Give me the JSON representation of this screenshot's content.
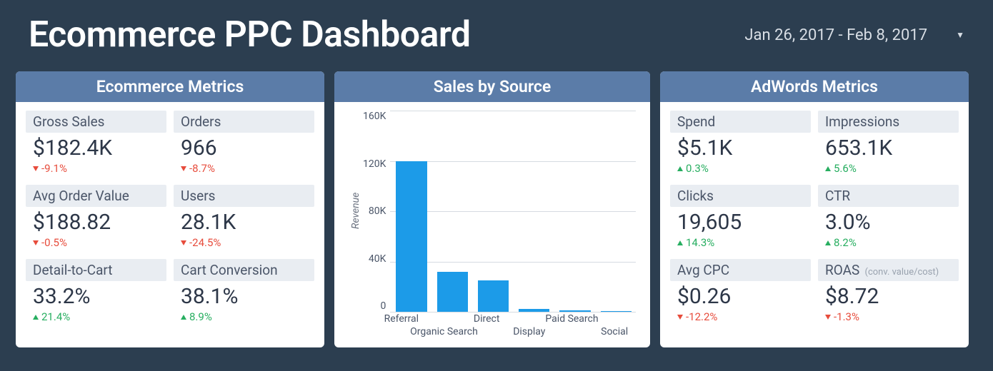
{
  "header": {
    "title": "Ecommerce PPC Dashboard",
    "date_range": "Jan 26, 2017 - Feb 8, 2017"
  },
  "panels": {
    "ecommerce": {
      "title": "Ecommerce Metrics",
      "metrics": [
        {
          "label": "Gross Sales",
          "value": "$182.4K",
          "delta": "-9.1%",
          "dir": "down"
        },
        {
          "label": "Orders",
          "value": "966",
          "delta": "-8.7%",
          "dir": "down"
        },
        {
          "label": "Avg Order Value",
          "value": "$188.82",
          "delta": "-0.5%",
          "dir": "down"
        },
        {
          "label": "Users",
          "value": "28.1K",
          "delta": "-24.5%",
          "dir": "down"
        },
        {
          "label": "Detail-to-Cart",
          "value": "33.2%",
          "delta": "21.4%",
          "dir": "up"
        },
        {
          "label": "Cart Conversion",
          "value": "38.1%",
          "delta": "8.9%",
          "dir": "up"
        }
      ]
    },
    "sales": {
      "title": "Sales by Source"
    },
    "adwords": {
      "title": "AdWords Metrics",
      "metrics": [
        {
          "label": "Spend",
          "value": "$5.1K",
          "delta": "0.3%",
          "dir": "up"
        },
        {
          "label": "Impressions",
          "value": "653.1K",
          "delta": "5.6%",
          "dir": "up"
        },
        {
          "label": "Clicks",
          "value": "19,605",
          "delta": "14.3%",
          "dir": "up"
        },
        {
          "label": "CTR",
          "value": "3.0%",
          "delta": "8.2%",
          "dir": "up"
        },
        {
          "label": "Avg CPC",
          "value": "$0.26",
          "delta": "-12.2%",
          "dir": "down"
        },
        {
          "label": "ROAS",
          "sublabel": "(conv. value/cost)",
          "value": "$8.72",
          "delta": "-1.3%",
          "dir": "down"
        }
      ]
    }
  },
  "chart_data": {
    "type": "bar",
    "title": "Sales by Source",
    "ylabel": "Revenue",
    "xlabel": "",
    "ylim": [
      0,
      160000
    ],
    "yticks": [
      "160K",
      "120K",
      "80K",
      "40K",
      "0"
    ],
    "categories": [
      "Referral",
      "Organic Search",
      "Direct",
      "Display",
      "Paid Search",
      "Social"
    ],
    "values": [
      120000,
      32000,
      25000,
      2000,
      1000,
      500
    ]
  },
  "colors": {
    "bar": "#1c9be8",
    "panel_header": "#5b7ca8",
    "up": "#27ae60",
    "down": "#e74c3c",
    "bg": "#2c3e50"
  }
}
